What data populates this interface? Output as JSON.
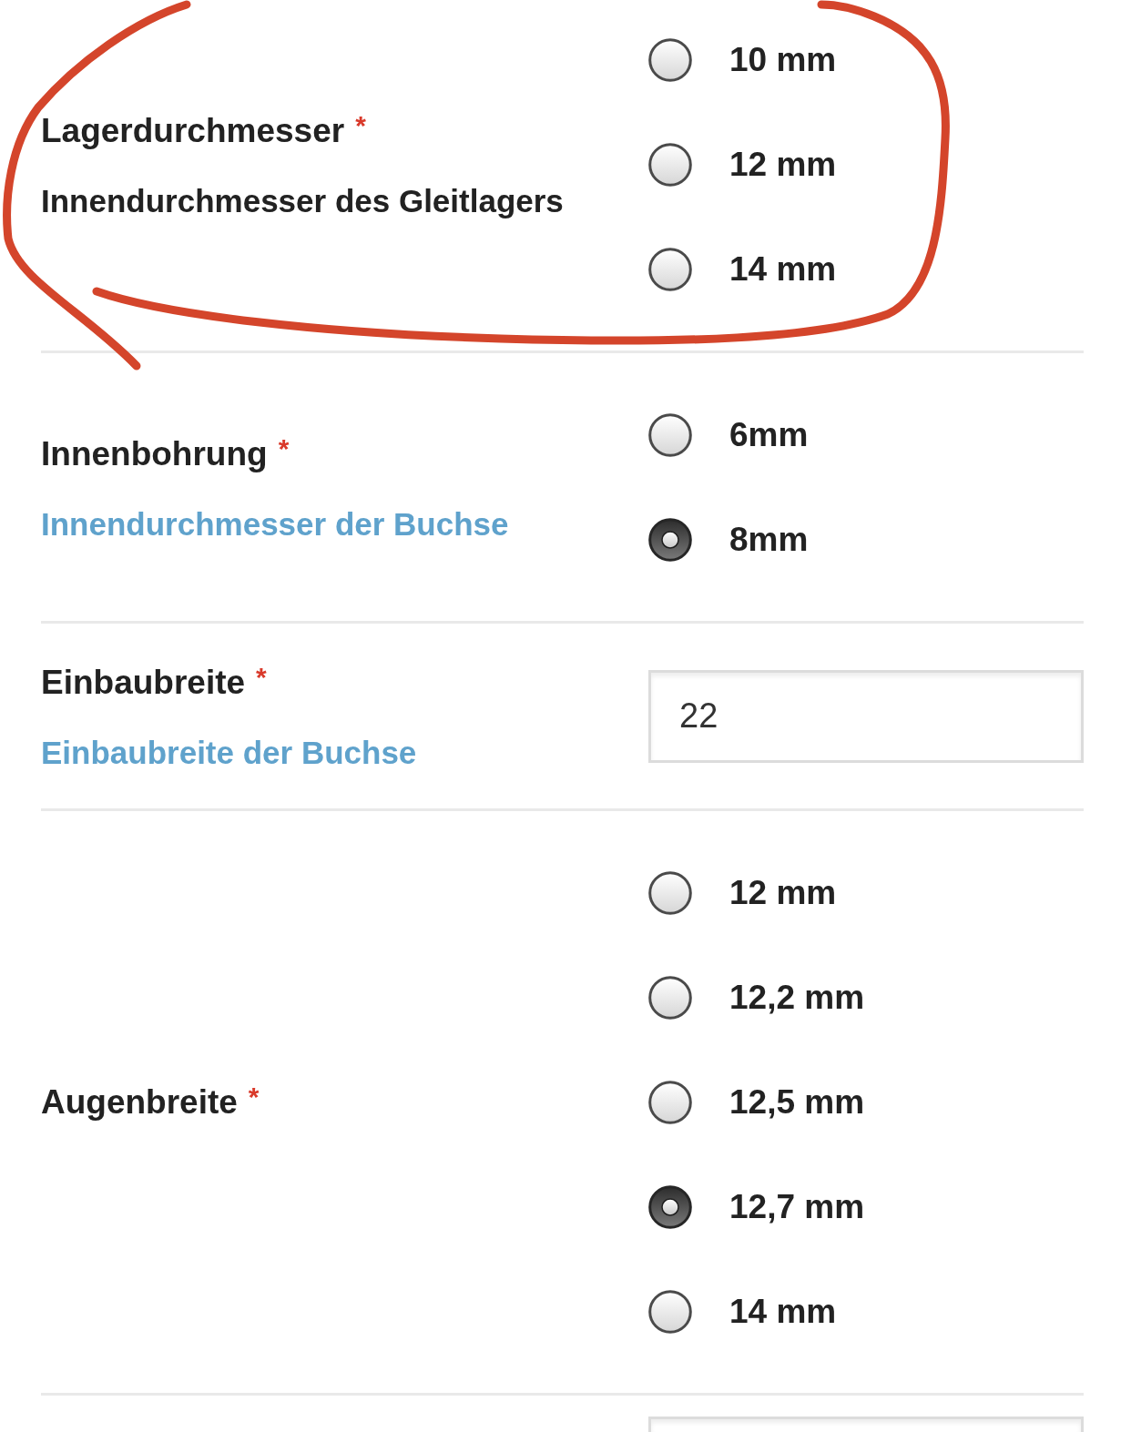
{
  "annotation": {
    "kind": "freehand-loop"
  },
  "fields": [
    {
      "kind": "radio",
      "label": "Lagerdurchmesser",
      "required_mark": "*",
      "description": {
        "text": "Innendurchmesser des Gleitlagers",
        "color": "#222222"
      },
      "options": [
        {
          "label": "10 mm",
          "selected": false
        },
        {
          "label": "12 mm",
          "selected": false
        },
        {
          "label": "14 mm",
          "selected": false
        }
      ]
    },
    {
      "kind": "radio",
      "label": "Innenbohrung",
      "required_mark": "*",
      "description": {
        "text": "Innendurchmesser der Buchse",
        "color": "#5fa2cc"
      },
      "options": [
        {
          "label": "6mm",
          "selected": false
        },
        {
          "label": "8mm",
          "selected": true
        }
      ]
    },
    {
      "kind": "text",
      "label": "Einbaubreite",
      "required_mark": "*",
      "description": {
        "text": "Einbaubreite der Buchse",
        "color": "#5fa2cc"
      },
      "value": "22"
    },
    {
      "kind": "radio",
      "label": "Augenbreite",
      "required_mark": "*",
      "options": [
        {
          "label": "12 mm",
          "selected": false
        },
        {
          "label": "12,2 mm",
          "selected": false
        },
        {
          "label": "12,5 mm",
          "selected": false
        },
        {
          "label": "12,7 mm",
          "selected": true
        },
        {
          "label": "14 mm",
          "selected": false
        }
      ]
    },
    {
      "kind": "text"
    }
  ]
}
